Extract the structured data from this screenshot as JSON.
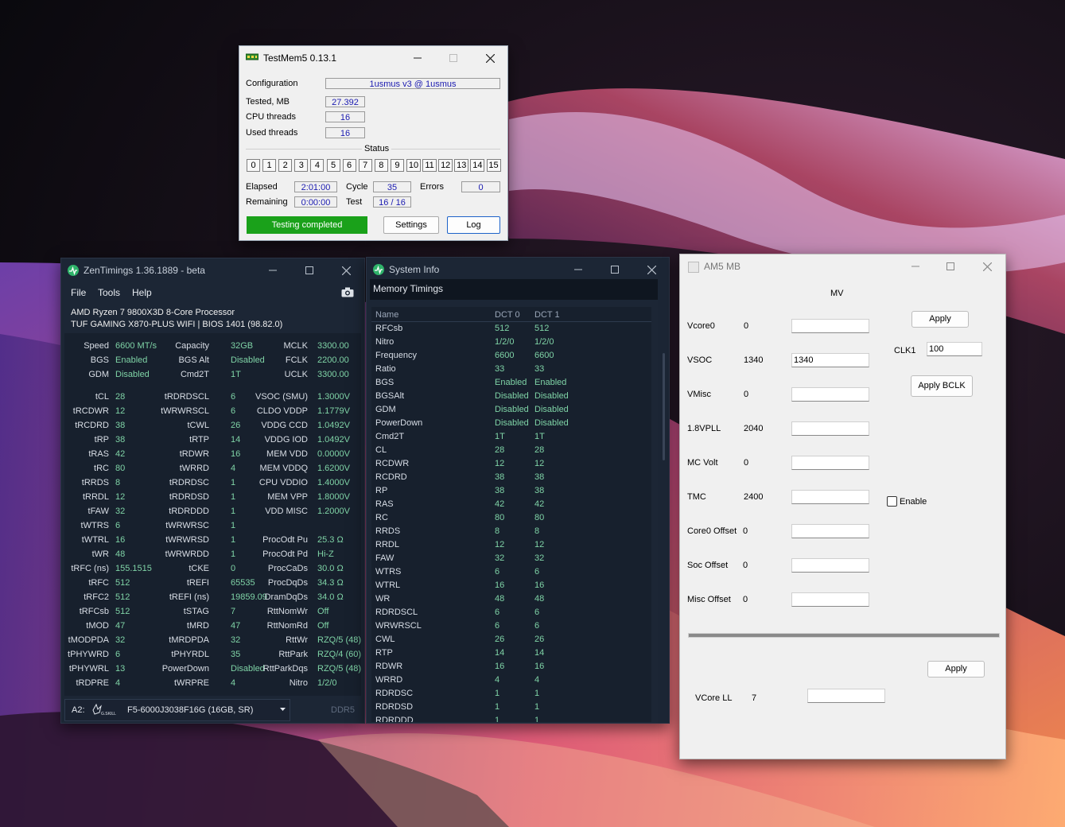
{
  "testmem5": {
    "title": "TestMem5  0.13.1",
    "configuration_label": "Configuration",
    "configuration_value": "1usmus v3 @ 1usmus",
    "tested_label": "Tested, MB",
    "tested_value": "27.392",
    "cpu_threads_label": "CPU threads",
    "cpu_threads_value": "16",
    "used_threads_label": "Used threads",
    "used_threads_value": "16",
    "status_label": "Status",
    "threads": [
      "0",
      "1",
      "2",
      "3",
      "4",
      "5",
      "6",
      "7",
      "8",
      "9",
      "10",
      "11",
      "12",
      "13",
      "14",
      "15"
    ],
    "elapsed_label": "Elapsed",
    "elapsed_value": "2:01:00",
    "remaining_label": "Remaining",
    "remaining_value": "0:00:00",
    "cycle_label": "Cycle",
    "cycle_value": "35",
    "test_label": "Test",
    "test_value": "16 / 16",
    "errors_label": "Errors",
    "errors_value": "0",
    "status_text": "Testing completed",
    "settings_button": "Settings",
    "log_button": "Log",
    "status_color": "#1aa11a"
  },
  "zentimings": {
    "title": "ZenTimings 1.36.1889 - beta",
    "menu": [
      "File",
      "Tools",
      "Help"
    ],
    "cpu": "AMD Ryzen 7 9800X3D 8-Core Processor",
    "board": "TUF GAMING X870-PLUS WIFI | BIOS 1401 (98.82.0)",
    "top": [
      [
        [
          "Speed",
          "6600 MT/s"
        ],
        [
          "Capacity",
          "32GB"
        ],
        [
          "MCLK",
          "3300.00"
        ]
      ],
      [
        [
          "BGS",
          "Enabled"
        ],
        [
          "BGS Alt",
          "Disabled"
        ],
        [
          "FCLK",
          "2200.00"
        ]
      ],
      [
        [
          "GDM",
          "Disabled"
        ],
        [
          "Cmd2T",
          "1T"
        ],
        [
          "UCLK",
          "3300.00"
        ]
      ]
    ],
    "col1": [
      [
        "tCL",
        "28"
      ],
      [
        "tRCDWR",
        "12"
      ],
      [
        "tRCDRD",
        "38"
      ],
      [
        "tRP",
        "38"
      ],
      [
        "tRAS",
        "42"
      ],
      [
        "tRC",
        "80"
      ],
      [
        "tRRDS",
        "8"
      ],
      [
        "tRRDL",
        "12"
      ],
      [
        "tFAW",
        "32"
      ],
      [
        "tWTRS",
        "6"
      ],
      [
        "tWTRL",
        "16"
      ],
      [
        "tWR",
        "48"
      ],
      [
        "tRFC (ns)",
        "155.1515"
      ],
      [
        "tRFC",
        "512"
      ],
      [
        "tRFC2",
        "512"
      ],
      [
        "tRFCsb",
        "512"
      ],
      [
        "tMOD",
        "47"
      ],
      [
        "tMODPDA",
        "32"
      ],
      [
        "tPHYWRD",
        "6"
      ],
      [
        "tPHYWRL",
        "13"
      ],
      [
        "tRDPRE",
        "4"
      ]
    ],
    "col2": [
      [
        "tRDRDSCL",
        "6"
      ],
      [
        "tWRWRSCL",
        "6"
      ],
      [
        "tCWL",
        "26"
      ],
      [
        "tRTP",
        "14"
      ],
      [
        "tRDWR",
        "16"
      ],
      [
        "tWRRD",
        "4"
      ],
      [
        "tRDRDSC",
        "1"
      ],
      [
        "tRDRDSD",
        "1"
      ],
      [
        "tRDRDDD",
        "1"
      ],
      [
        "tWRWRSC",
        "1"
      ],
      [
        "tWRWRSD",
        "1"
      ],
      [
        "tWRWRDD",
        "1"
      ],
      [
        "tCKE",
        "0"
      ],
      [
        "tREFI",
        "65535"
      ],
      [
        "tREFI (ns)",
        "19859.09"
      ],
      [
        "tSTAG",
        "7"
      ],
      [
        "tMRD",
        "47"
      ],
      [
        "tMRDPDA",
        "32"
      ],
      [
        "tPHYRDL",
        "35"
      ],
      [
        "PowerDown",
        "Disabled"
      ],
      [
        "tWRPRE",
        "4"
      ]
    ],
    "col3": [
      [
        "VSOC (SMU)",
        "1.3000V"
      ],
      [
        "CLDO VDDP",
        "1.1779V"
      ],
      [
        "VDDG CCD",
        "1.0492V"
      ],
      [
        "VDDG IOD",
        "1.0492V"
      ],
      [
        "MEM VDD",
        "0.0000V"
      ],
      [
        "MEM VDDQ",
        "1.6200V"
      ],
      [
        "CPU VDDIO",
        "1.4000V"
      ],
      [
        "MEM VPP",
        "1.8000V"
      ],
      [
        "VDD MISC",
        "1.2000V"
      ],
      [
        "",
        ""
      ],
      [
        "ProcOdt Pu",
        "25.3 Ω"
      ],
      [
        "ProcOdt Pd",
        "Hi-Z"
      ],
      [
        "ProcCaDs",
        "30.0 Ω"
      ],
      [
        "ProcDqDs",
        "34.3 Ω"
      ],
      [
        "DramDqDs",
        "34.0 Ω"
      ],
      [
        "RttNomWr",
        "Off"
      ],
      [
        "RttNomRd",
        "Off"
      ],
      [
        "RttWr",
        "RZQ/5 (48)"
      ],
      [
        "RttPark",
        "RZQ/4 (60)"
      ],
      [
        "RttParkDqs",
        "RZQ/5 (48)"
      ],
      [
        "Nitro",
        "1/2/0"
      ]
    ],
    "dimm_slot": "A2:",
    "dimm_brand": "G.SKILL",
    "dimm_name": "F5-6000J3038F16G (16GB, SR)",
    "dimm_type": "DDR5"
  },
  "sysinfo": {
    "title": "System Info",
    "section": "Memory Timings",
    "headers": [
      "Name",
      "DCT 0",
      "DCT 1"
    ],
    "rows": [
      [
        "RFCsb",
        "512",
        "512"
      ],
      [
        "Nitro",
        "1/2/0",
        "1/2/0"
      ],
      [
        "Frequency",
        "6600",
        "6600"
      ],
      [
        "Ratio",
        "33",
        "33"
      ],
      [
        "BGS",
        "Enabled",
        "Enabled"
      ],
      [
        "BGSAlt",
        "Disabled",
        "Disabled"
      ],
      [
        "GDM",
        "Disabled",
        "Disabled"
      ],
      [
        "PowerDown",
        "Disabled",
        "Disabled"
      ],
      [
        "Cmd2T",
        "1T",
        "1T"
      ],
      [
        "CL",
        "28",
        "28"
      ],
      [
        "RCDWR",
        "12",
        "12"
      ],
      [
        "RCDRD",
        "38",
        "38"
      ],
      [
        "RP",
        "38",
        "38"
      ],
      [
        "RAS",
        "42",
        "42"
      ],
      [
        "RC",
        "80",
        "80"
      ],
      [
        "RRDS",
        "8",
        "8"
      ],
      [
        "RRDL",
        "12",
        "12"
      ],
      [
        "FAW",
        "32",
        "32"
      ],
      [
        "WTRS",
        "6",
        "6"
      ],
      [
        "WTRL",
        "16",
        "16"
      ],
      [
        "WR",
        "48",
        "48"
      ],
      [
        "RDRDSCL",
        "6",
        "6"
      ],
      [
        "WRWRSCL",
        "6",
        "6"
      ],
      [
        "CWL",
        "26",
        "26"
      ],
      [
        "RTP",
        "14",
        "14"
      ],
      [
        "RDWR",
        "16",
        "16"
      ],
      [
        "WRRD",
        "4",
        "4"
      ],
      [
        "RDRDSC",
        "1",
        "1"
      ],
      [
        "RDRDSD",
        "1",
        "1"
      ],
      [
        "RDRDDD",
        "1",
        "1"
      ]
    ]
  },
  "am5": {
    "title": "AM5 MB",
    "mv_label": "MV",
    "rows": [
      {
        "label": "Vcore0",
        "value": "0",
        "input": ""
      },
      {
        "label": "VSOC",
        "value": "1340",
        "input": "1340"
      },
      {
        "label": "VMisc",
        "value": "0",
        "input": ""
      },
      {
        "label": "1.8VPLL",
        "value": "2040",
        "input": ""
      },
      {
        "label": "MC Volt",
        "value": "0",
        "input": ""
      },
      {
        "label": "TMC",
        "value": "2400",
        "input": ""
      },
      {
        "label": "Core0 Offset",
        "value": "0",
        "input": ""
      },
      {
        "label": "Soc Offset",
        "value": "0",
        "input": ""
      },
      {
        "label": "Misc Offset",
        "value": "0",
        "input": ""
      }
    ],
    "apply_top": "Apply",
    "clk_label": "CLK1",
    "clk_value": "100",
    "apply_bclk": "Apply BCLK",
    "enable_label": "Enable",
    "apply_bottom": "Apply",
    "vcore_ll_label": "VCore LL",
    "vcore_ll_value": "7",
    "vcore_ll_input": ""
  }
}
